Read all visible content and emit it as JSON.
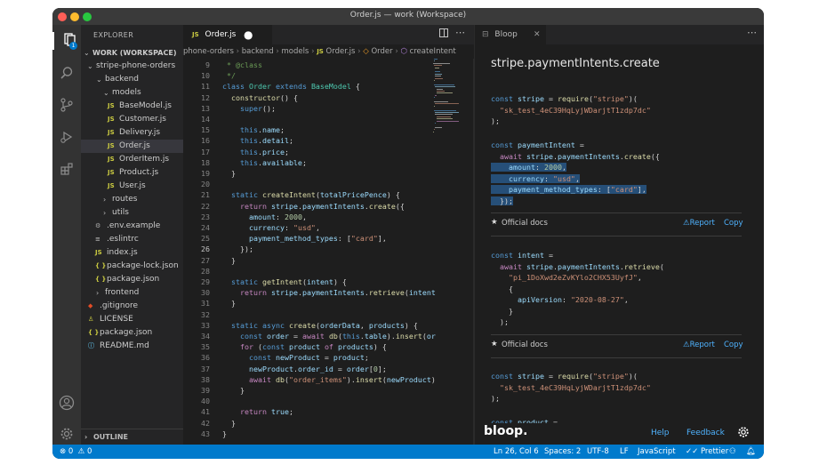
{
  "window": {
    "title": "Order.js — work (Workspace)"
  },
  "explorer": {
    "header": "EXPLORER",
    "workspace": "WORK (WORKSPACE)",
    "items": [
      {
        "label": "stripe-phone-orders",
        "type": "folder-open"
      },
      {
        "label": "backend",
        "type": "folder-open"
      },
      {
        "label": "models",
        "type": "folder-open"
      },
      {
        "label": "BaseModel.js",
        "type": "js"
      },
      {
        "label": "Customer.js",
        "type": "js"
      },
      {
        "label": "Delivery.js",
        "type": "js"
      },
      {
        "label": "Order.js",
        "type": "js",
        "selected": true
      },
      {
        "label": "OrderItem.js",
        "type": "js"
      },
      {
        "label": "Product.js",
        "type": "js"
      },
      {
        "label": "User.js",
        "type": "js"
      },
      {
        "label": "routes",
        "type": "folder"
      },
      {
        "label": "utils",
        "type": "folder"
      },
      {
        "label": ".env.example",
        "type": "env"
      },
      {
        "label": ".eslintrc",
        "type": "eslint"
      },
      {
        "label": "index.js",
        "type": "js"
      },
      {
        "label": "package-lock.json",
        "type": "json"
      },
      {
        "label": "package.json",
        "type": "json"
      },
      {
        "label": "frontend",
        "type": "folder"
      },
      {
        "label": ".gitignore",
        "type": "git"
      },
      {
        "label": "LICENSE",
        "type": "license"
      },
      {
        "label": "package.json",
        "type": "json"
      },
      {
        "label": "README.md",
        "type": "md"
      }
    ],
    "outline": "OUTLINE"
  },
  "editor": {
    "tab": {
      "icon": "JS",
      "label": "Order.js"
    },
    "breadcrumb": [
      "phone-orders",
      "backend",
      "models",
      "Order.js",
      "Order",
      "createIntent"
    ],
    "lines": [
      {
        "n": "9",
        "code": " * @class"
      },
      {
        "n": "10",
        "code": " */"
      },
      {
        "n": "11",
        "code": "class Order extends BaseModel {"
      },
      {
        "n": "12",
        "code": "  constructor() {"
      },
      {
        "n": "13",
        "code": "    super();"
      },
      {
        "n": "14",
        "code": ""
      },
      {
        "n": "15",
        "code": "    this.name;"
      },
      {
        "n": "16",
        "code": "    this.detail;"
      },
      {
        "n": "17",
        "code": "    this.price;"
      },
      {
        "n": "18",
        "code": "    this.available;"
      },
      {
        "n": "19",
        "code": "  }"
      },
      {
        "n": "20",
        "code": ""
      },
      {
        "n": "21",
        "code": "  static createIntent(totalPricePence) {"
      },
      {
        "n": "22",
        "code": "    return stripe.paymentIntents.create({"
      },
      {
        "n": "23",
        "code": "      amount: 2000,"
      },
      {
        "n": "24",
        "code": "      currency: \"usd\","
      },
      {
        "n": "25",
        "code": "      payment_method_types: [\"card\"],"
      },
      {
        "n": "26",
        "code": "    });"
      },
      {
        "n": "27",
        "code": "  }"
      },
      {
        "n": "28",
        "code": ""
      },
      {
        "n": "29",
        "code": "  static getIntent(intent) {"
      },
      {
        "n": "30",
        "code": "    return stripe.paymentIntents.retrieve(intent"
      },
      {
        "n": "31",
        "code": "  }"
      },
      {
        "n": "32",
        "code": ""
      },
      {
        "n": "33",
        "code": "  static async create(orderData, products) {"
      },
      {
        "n": "34",
        "code": "    const order = await db(this.table).insert(or"
      },
      {
        "n": "35",
        "code": "    for (const product of products) {"
      },
      {
        "n": "36",
        "code": "      const newProduct = product;"
      },
      {
        "n": "37",
        "code": "      newProduct.order_id = order[0];"
      },
      {
        "n": "38",
        "code": "      await db(\"order_items\").insert(newProduct)"
      },
      {
        "n": "39",
        "code": "    }"
      },
      {
        "n": "40",
        "code": ""
      },
      {
        "n": "41",
        "code": "    return true;"
      },
      {
        "n": "42",
        "code": "  }"
      },
      {
        "n": "43",
        "code": "}"
      }
    ]
  },
  "bloop": {
    "tab": "Bloop",
    "title": "stripe.paymentIntents.create",
    "snippet1": [
      "const stripe = require(\"stripe\")(",
      "  \"sk_test_4eC39HqLyjWDarjtT1zdp7dc\"",
      ");"
    ],
    "snippet2": [
      "const paymentIntent =",
      "  await stripe.paymentIntents.create({",
      "    amount: 2000,",
      "    currency: \"usd\",",
      "    payment_method_types: [\"card\"],",
      "  });"
    ],
    "doc_row": {
      "label": "Official docs",
      "report": "Report",
      "copy": "Copy"
    },
    "snippet3": [
      "const intent =",
      "  await stripe.paymentIntents.retrieve(",
      "    \"pi_1DoXwd2eZvKYlo2CHX53UyfJ\",",
      "    {",
      "      apiVersion: \"2020-08-27\",",
      "    }",
      "  );"
    ],
    "snippet4": [
      "const stripe = require(\"stripe\")(",
      "  \"sk_test_4eC39HqLyjWDarjtT1zdp7dc\"",
      ");"
    ],
    "snippet5": [
      "const product ="
    ],
    "footer": {
      "logo": "bloop.",
      "help": "Help",
      "feedback": "Feedback"
    }
  },
  "statusbar": {
    "errors": "0",
    "warnings": "0",
    "position": "Ln 26, Col 6",
    "spaces": "Spaces: 2",
    "encoding": "UTF-8",
    "eol": "LF",
    "language": "JavaScript",
    "prettier": "Prettier"
  },
  "colors": {
    "accent": "#007acc",
    "link": "#4fb3ff",
    "selection": "#264f78"
  }
}
